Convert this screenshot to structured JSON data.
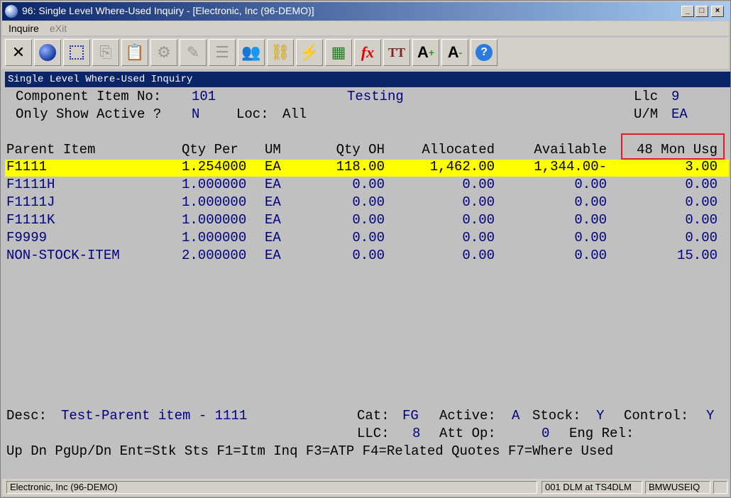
{
  "window": {
    "title": "96: Single Level Where-Used Inquiry - [Electronic, Inc (96-DEMO)]"
  },
  "menu": {
    "inquire": "Inquire",
    "exit": "eXit"
  },
  "toolbar": {
    "icons": [
      "close-icon",
      "globe-icon",
      "select-icon",
      "copy-icon",
      "paste-icon",
      "settings-icon",
      "edit-icon",
      "list-icon",
      "users-icon",
      "link-icon",
      "lightning-icon",
      "calendar-icon",
      "function-icon",
      "text-size-icon",
      "font-grow-icon",
      "font-shrink-icon",
      "help-icon"
    ],
    "fx": "fx",
    "tt": "TT",
    "a_plus": "A",
    "a_minus": "A",
    "help": "?"
  },
  "screen": {
    "header": "Single Level Where-Used Inquiry",
    "component_label": "Component Item No:",
    "component_value": "101",
    "component_desc": "Testing",
    "llc_label": "Llc",
    "llc_value": "9",
    "active_label": "Only Show Active ?",
    "active_value": "N",
    "loc_label": "Loc:",
    "loc_value": "All",
    "um_label": "U/M",
    "um_value": "EA"
  },
  "table": {
    "columns": [
      "Parent Item",
      "Qty Per",
      "UM",
      "Qty OH",
      "Allocated",
      "Available",
      "48 Mon Usg"
    ],
    "rows": [
      [
        "F1111",
        "1.254000",
        "EA",
        "118.00",
        "1,462.00",
        "1,344.00-",
        "3.00"
      ],
      [
        "F1111H",
        "1.000000",
        "EA",
        "0.00",
        "0.00",
        "0.00",
        "0.00"
      ],
      [
        "F1111J",
        "1.000000",
        "EA",
        "0.00",
        "0.00",
        "0.00",
        "0.00"
      ],
      [
        "F1111K",
        "1.000000",
        "EA",
        "0.00",
        "0.00",
        "0.00",
        "0.00"
      ],
      [
        "F9999",
        "1.000000",
        "EA",
        "0.00",
        "0.00",
        "0.00",
        "0.00"
      ],
      [
        "NON-STOCK-ITEM",
        "2.000000",
        "EA",
        "0.00",
        "0.00",
        "0.00",
        "15.00"
      ]
    ]
  },
  "footer": {
    "desc_label": "Desc:",
    "desc_value": "Test-Parent item - 1111",
    "cat_label": "Cat:",
    "cat_value": "FG",
    "active_label": "Active:",
    "active_value": "A",
    "stock_label": "Stock:",
    "stock_value": "Y",
    "control_label": "Control:",
    "control_value": "Y",
    "llc_label": "LLC:",
    "llc_value": "8",
    "attop_label": "Att Op:",
    "attop_value": "0",
    "engrel_label": "Eng Rel:",
    "keys": "Up Dn PgUp/Dn Ent=Stk Sts F1=Itm Inq F3=ATP F4=Related Quotes F7=Where Used"
  },
  "statusbar": {
    "company": "Electronic, Inc (96-DEMO)",
    "session": "001 DLM at TS4DLM",
    "program": "BMWUSEIQ"
  },
  "colors": {
    "title": "#0a246a",
    "highlight": "#ffff00",
    "value": "#00007f",
    "callout": "#e02020"
  }
}
